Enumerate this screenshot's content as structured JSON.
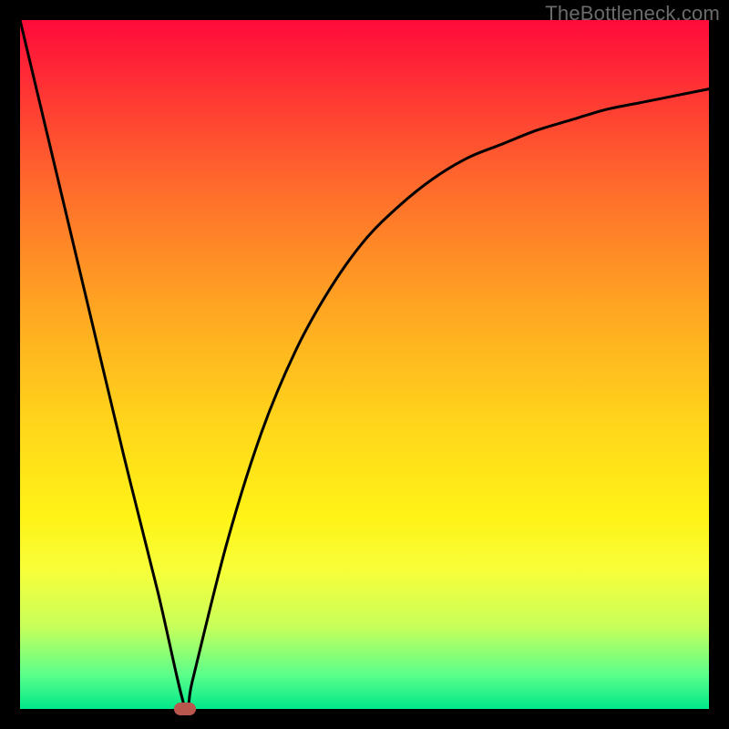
{
  "watermark": "TheBottleneck.com",
  "colors": {
    "gradient_top": "#ff0a3a",
    "gradient_bottom": "#00e88a",
    "curve": "#000000",
    "frame": "#000000",
    "marker": "#b9564e"
  },
  "chart_data": {
    "type": "line",
    "title": "",
    "xlabel": "",
    "ylabel": "",
    "xlim": [
      0,
      100
    ],
    "ylim": [
      0,
      100
    ],
    "axes_visible": false,
    "grid": false,
    "legend": false,
    "series": [
      {
        "name": "bottleneck-curve",
        "x": [
          0,
          5,
          10,
          15,
          20,
          24,
          25,
          30,
          35,
          40,
          45,
          50,
          55,
          60,
          65,
          70,
          75,
          80,
          85,
          90,
          95,
          100
        ],
        "y": [
          100,
          79,
          58,
          37,
          17,
          0,
          4,
          24,
          40,
          52,
          61,
          68,
          73,
          77,
          80,
          82,
          84,
          85.5,
          87,
          88,
          89,
          90
        ]
      }
    ],
    "marker": {
      "x": 24,
      "y": 0
    },
    "background_gradient": {
      "direction": "vertical",
      "stops": [
        {
          "pos": 0.0,
          "color": "#ff0a3a"
        },
        {
          "pos": 0.12,
          "color": "#ff3b33"
        },
        {
          "pos": 0.24,
          "color": "#ff6a2c"
        },
        {
          "pos": 0.36,
          "color": "#ff9325"
        },
        {
          "pos": 0.48,
          "color": "#ffb81f"
        },
        {
          "pos": 0.6,
          "color": "#ffd91a"
        },
        {
          "pos": 0.72,
          "color": "#fff316"
        },
        {
          "pos": 0.8,
          "color": "#f6ff3a"
        },
        {
          "pos": 0.88,
          "color": "#c8ff5a"
        },
        {
          "pos": 0.95,
          "color": "#5cff8a"
        },
        {
          "pos": 1.0,
          "color": "#00e88a"
        }
      ]
    }
  }
}
